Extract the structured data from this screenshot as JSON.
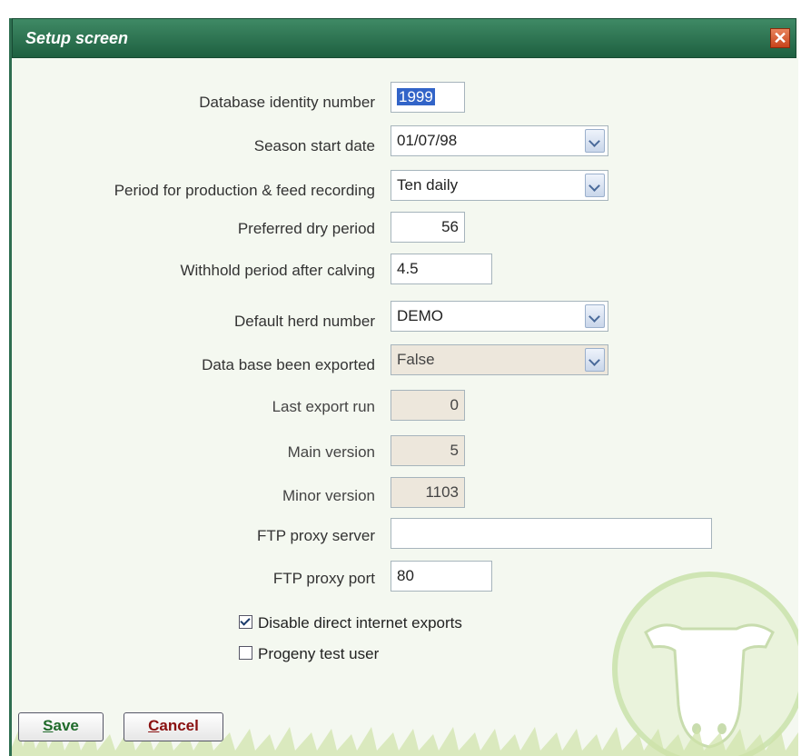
{
  "window": {
    "title": "Setup screen",
    "close_glyph": "✕"
  },
  "fields": {
    "db_identity": {
      "label": "Database identity number",
      "value": "1999"
    },
    "season_start": {
      "label": "Season start date",
      "value": "01/07/98"
    },
    "period": {
      "label": "Period for production & feed recording",
      "value": "Ten daily"
    },
    "dry_period": {
      "label": "Preferred dry period",
      "value": "56"
    },
    "withhold": {
      "label": "Withhold period after calving",
      "value": "4.5"
    },
    "herd": {
      "label": "Default herd number",
      "value": "DEMO"
    },
    "exported": {
      "label": "Data base been exported",
      "value": "False"
    },
    "last_export": {
      "label": "Last export run",
      "value": "0"
    },
    "main_version": {
      "label": "Main version",
      "value": "5"
    },
    "minor_version": {
      "label": "Minor version",
      "value": "1103"
    },
    "ftp_server": {
      "label": "FTP proxy server",
      "value": ""
    },
    "ftp_port": {
      "label": "FTP proxy port",
      "value": "80"
    }
  },
  "checkboxes": {
    "disable_exports": {
      "label": "Disable direct internet exports",
      "checked": true
    },
    "progeny": {
      "label": "Progeny test user",
      "checked": false
    }
  },
  "buttons": {
    "save": {
      "mnemonic": "S",
      "rest": "ave"
    },
    "cancel": {
      "mnemonic": "C",
      "rest": "ancel"
    }
  },
  "colors": {
    "title_bar": "#2a7350",
    "accent_green": "#8fc25a"
  },
  "icons": {
    "logo": "cow-head-logo",
    "close": "close-icon"
  }
}
